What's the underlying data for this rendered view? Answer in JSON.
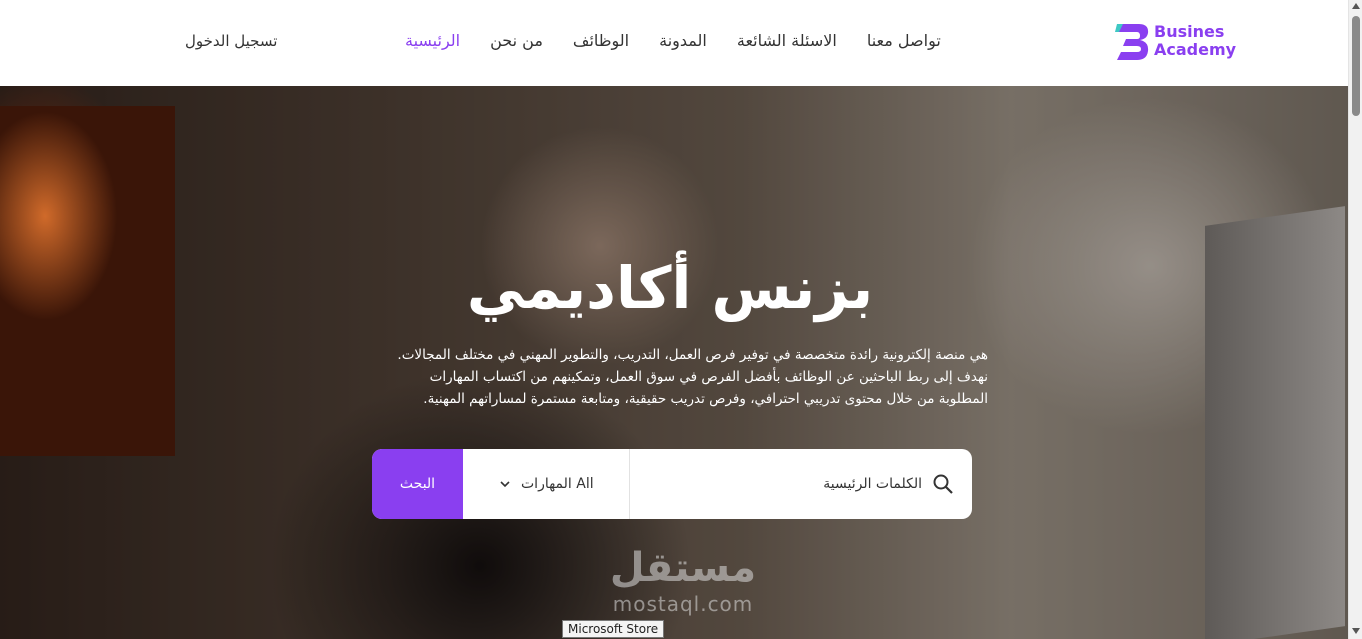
{
  "header": {
    "login_label": "تسجيل الدخول",
    "nav": [
      {
        "label": "الرئيسية",
        "active": true
      },
      {
        "label": "من نحن",
        "active": false
      },
      {
        "label": "الوظائف",
        "active": false
      },
      {
        "label": "المدونة",
        "active": false
      },
      {
        "label": "الاسئلة الشائعة",
        "active": false
      },
      {
        "label": "تواصل معنا",
        "active": false
      }
    ],
    "logo": {
      "line1": "Busines",
      "line2": "Academy",
      "icon": "b-logo-icon"
    }
  },
  "hero": {
    "title": "بزنس أكاديمي",
    "description_lines": [
      "هي منصة إلكترونية رائدة متخصصة في توفير فرص العمل، التدريب، والتطوير المهني في مختلف المجالات.",
      "نهدف إلى ربط الباحثين عن الوظائف بأفضل الفرص في سوق العمل، وتمكينهم من اكتساب المهارات",
      "المطلوبة من خلال محتوى تدريبي احترافي، وفرص تدريب حقيقية، ومتابعة مستمرة لمساراتهم المهنية."
    ]
  },
  "search": {
    "keyword_placeholder": "الكلمات الرئيسية",
    "skills_value": "All المهارات",
    "button_label": "البحث",
    "icons": {
      "search": "search-icon",
      "dropdown": "chevron-down-icon"
    }
  },
  "watermark": {
    "arabic": "مستقل",
    "latin": "mostaql.com"
  },
  "tooltip": {
    "text": "Microsoft Store"
  },
  "colors": {
    "accent": "#8a3ff0",
    "text": "#333333",
    "white": "#ffffff"
  }
}
